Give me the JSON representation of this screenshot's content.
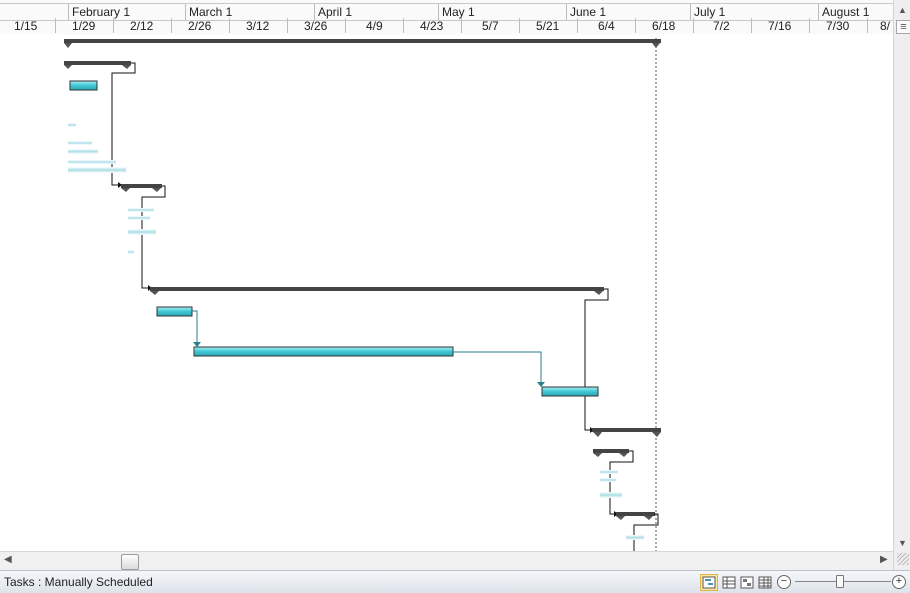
{
  "timescale": {
    "months": [
      "February 1",
      "March 1",
      "April 1",
      "May 1",
      "June 1",
      "July 1",
      "August 1"
    ],
    "weeks": [
      "1/15",
      "1/29",
      "2/12",
      "2/26",
      "3/12",
      "3/26",
      "4/9",
      "4/23",
      "5/7",
      "5/21",
      "6/4",
      "6/18",
      "7/2",
      "7/16",
      "7/30",
      "8/"
    ]
  },
  "status": {
    "task_mode": "Tasks : Manually Scheduled"
  },
  "colors": {
    "task_bar": "#3fc8d4",
    "summary_bar": "#4a4a4a",
    "link_teal": "#2a7f8c",
    "link_black": "#111111"
  },
  "icons": {
    "scroll_up": "▲",
    "scroll_down": "▼",
    "scroll_left": "◀",
    "scroll_right": "▶",
    "split_box": "≡",
    "resize_grip": "grip-icon",
    "zoom_out": "−",
    "zoom_in": "+"
  }
}
